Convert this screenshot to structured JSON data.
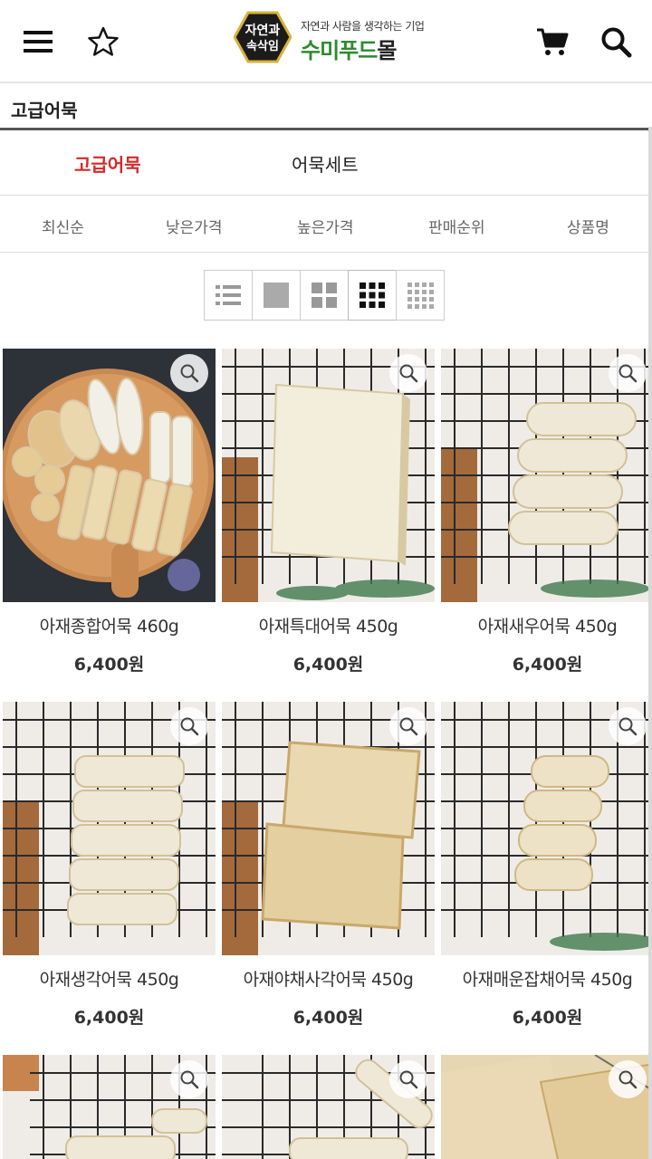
{
  "header": {
    "menu_icon": "hamburger-menu-icon",
    "favorite_icon": "star-outline-icon",
    "logo_badge_text": "자연과 속삭임",
    "logo_tagline": "자연과 사람을 생각하는 기업",
    "logo_name_green": "수미푸드",
    "logo_name_dark": "몰",
    "cart_icon": "cart-icon",
    "search_icon": "search-icon"
  },
  "breadcrumb": {
    "title": "고급어묵"
  },
  "tabs": [
    {
      "label": "고급어묵",
      "active": true
    },
    {
      "label": "어묵세트",
      "active": false
    }
  ],
  "sorts": [
    "최신순",
    "낮은가격",
    "높은가격",
    "판매순위",
    "상품명"
  ],
  "view_modes": [
    "list-view-icon",
    "single-grid-icon",
    "two-column-grid-icon",
    "three-column-grid-icon",
    "four-column-grid-icon"
  ],
  "active_view": "three-column-grid-icon",
  "colors": {
    "accent_red": "#d42a2a",
    "brand_green": "#2e8b2e"
  },
  "products": [
    {
      "name": "아재종합어묵 460g",
      "price": "6,400원"
    },
    {
      "name": "아재특대어묵 450g",
      "price": "6,400원"
    },
    {
      "name": "아재새우어묵 450g",
      "price": "6,400원"
    },
    {
      "name": "아재생각어묵 450g",
      "price": "6,400원"
    },
    {
      "name": "아재야채사각어묵 450g",
      "price": "6,400원"
    },
    {
      "name": "아재매운잡채어묵 450g",
      "price": "6,400원"
    },
    {
      "name": "",
      "price": ""
    },
    {
      "name": "",
      "price": ""
    },
    {
      "name": "",
      "price": ""
    }
  ]
}
